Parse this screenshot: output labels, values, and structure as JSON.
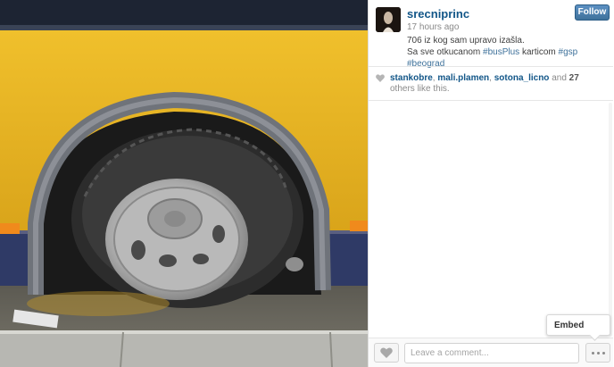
{
  "post": {
    "username": "srecniprinc",
    "timestamp": "17 hours ago",
    "follow_label": "Follow",
    "caption_line1": "706 iz kog sam upravo izašla.",
    "caption_line2_prefix": "Sa sve otkucanom ",
    "caption_tag1": "#busPlus",
    "caption_mid": " karticom ",
    "caption_tag2": "#gsp",
    "caption_space": " ",
    "caption_tag3": "#beograd"
  },
  "likes": {
    "user1": "stankobre",
    "sep1": ", ",
    "user2": "mali.plamen",
    "sep2": ", ",
    "user3": "sotona_licno",
    "and_text": " and ",
    "count": "27",
    "suffix": " others like this."
  },
  "footer": {
    "comment_placeholder": "Leave a comment...",
    "embed_label": "Embed"
  },
  "icons": {
    "heart": "heart-icon",
    "more": "ellipsis-icon"
  },
  "colors": {
    "link": "#125688",
    "tag": "#3f729b",
    "follow_button": "#3f729b",
    "bus_yellow": "#e8b623"
  }
}
